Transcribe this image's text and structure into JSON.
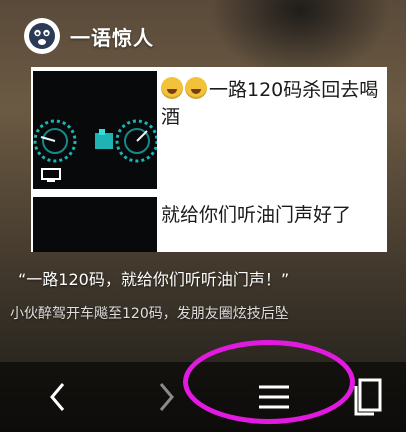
{
  "header": {
    "brand_name": "一语惊人",
    "avatar_icon": "face-icon"
  },
  "card": {
    "item1": {
      "caption": "一路120码杀回去喝酒",
      "emoji_icons": [
        "grin-emoji-icon",
        "grin-emoji-icon"
      ]
    },
    "item2": {
      "caption": "就给你们听油门声好了"
    }
  },
  "article": {
    "quote": "“一路120码，就给你们听听油门声！”",
    "description": "小伙醉驾开车飚至120码，发朋友圈炫技后坠"
  },
  "navbar": {
    "back_icon": "chevron-left-icon",
    "forward_icon": "chevron-right-icon",
    "menu_icon": "hamburger-menu-icon",
    "tabs_icon": "tabs-icon"
  },
  "colors": {
    "highlight": "#e21ae0",
    "emoji": "#f3c23b"
  }
}
